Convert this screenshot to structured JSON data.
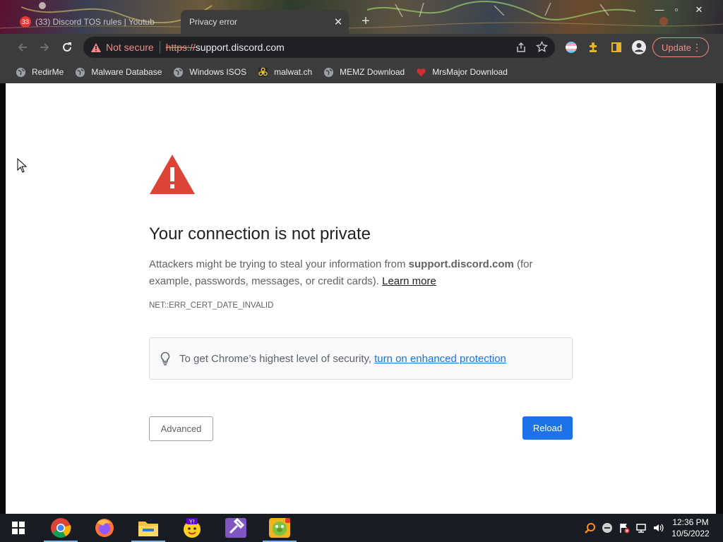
{
  "browser": {
    "tabs": [
      {
        "title": "(33) Discord TOS rules | Youtub",
        "badge": "33",
        "active": false
      },
      {
        "title": "Privacy error",
        "active": true
      }
    ],
    "new_tab": "+",
    "address": {
      "security_label": "Not secure",
      "scheme": "https://",
      "host": "support.discord.com"
    },
    "update_label": "Update",
    "bookmarks": [
      {
        "label": "RedirMe",
        "icon": "globe-icon"
      },
      {
        "label": "Malware Database",
        "icon": "globe-icon"
      },
      {
        "label": "Windows ISOS",
        "icon": "globe-icon"
      },
      {
        "label": "malwat.ch",
        "icon": "biohazard-icon"
      },
      {
        "label": "MEMZ Download",
        "icon": "globe-icon"
      },
      {
        "label": "MrsMajor Download",
        "icon": "heart-icon"
      }
    ]
  },
  "page": {
    "heading": "Your connection is not private",
    "body_prefix": "Attackers might be trying to steal your information from ",
    "body_host": "support.discord.com",
    "body_suffix": " (for example, passwords, messages, or credit cards). ",
    "learn_more": "Learn more",
    "error_code": "NET::ERR_CERT_DATE_INVALID",
    "tip_text": "To get Chrome’s highest level of security,",
    "tip_link": "turn on enhanced protection",
    "advanced_label": "Advanced",
    "reload_label": "Reload"
  },
  "taskbar": {
    "time": "12:36 PM",
    "date": "10/5/2022",
    "apps": [
      "windows-start",
      "chrome",
      "firefox",
      "file-explorer",
      "yahoo-messenger",
      "visual-studio",
      "bad-piggies"
    ]
  },
  "colors": {
    "warning_red": "#db4437",
    "link_blue": "#1a73e8",
    "not_secure": "#f28b82",
    "toolbar_bg": "#3c3c3c"
  }
}
